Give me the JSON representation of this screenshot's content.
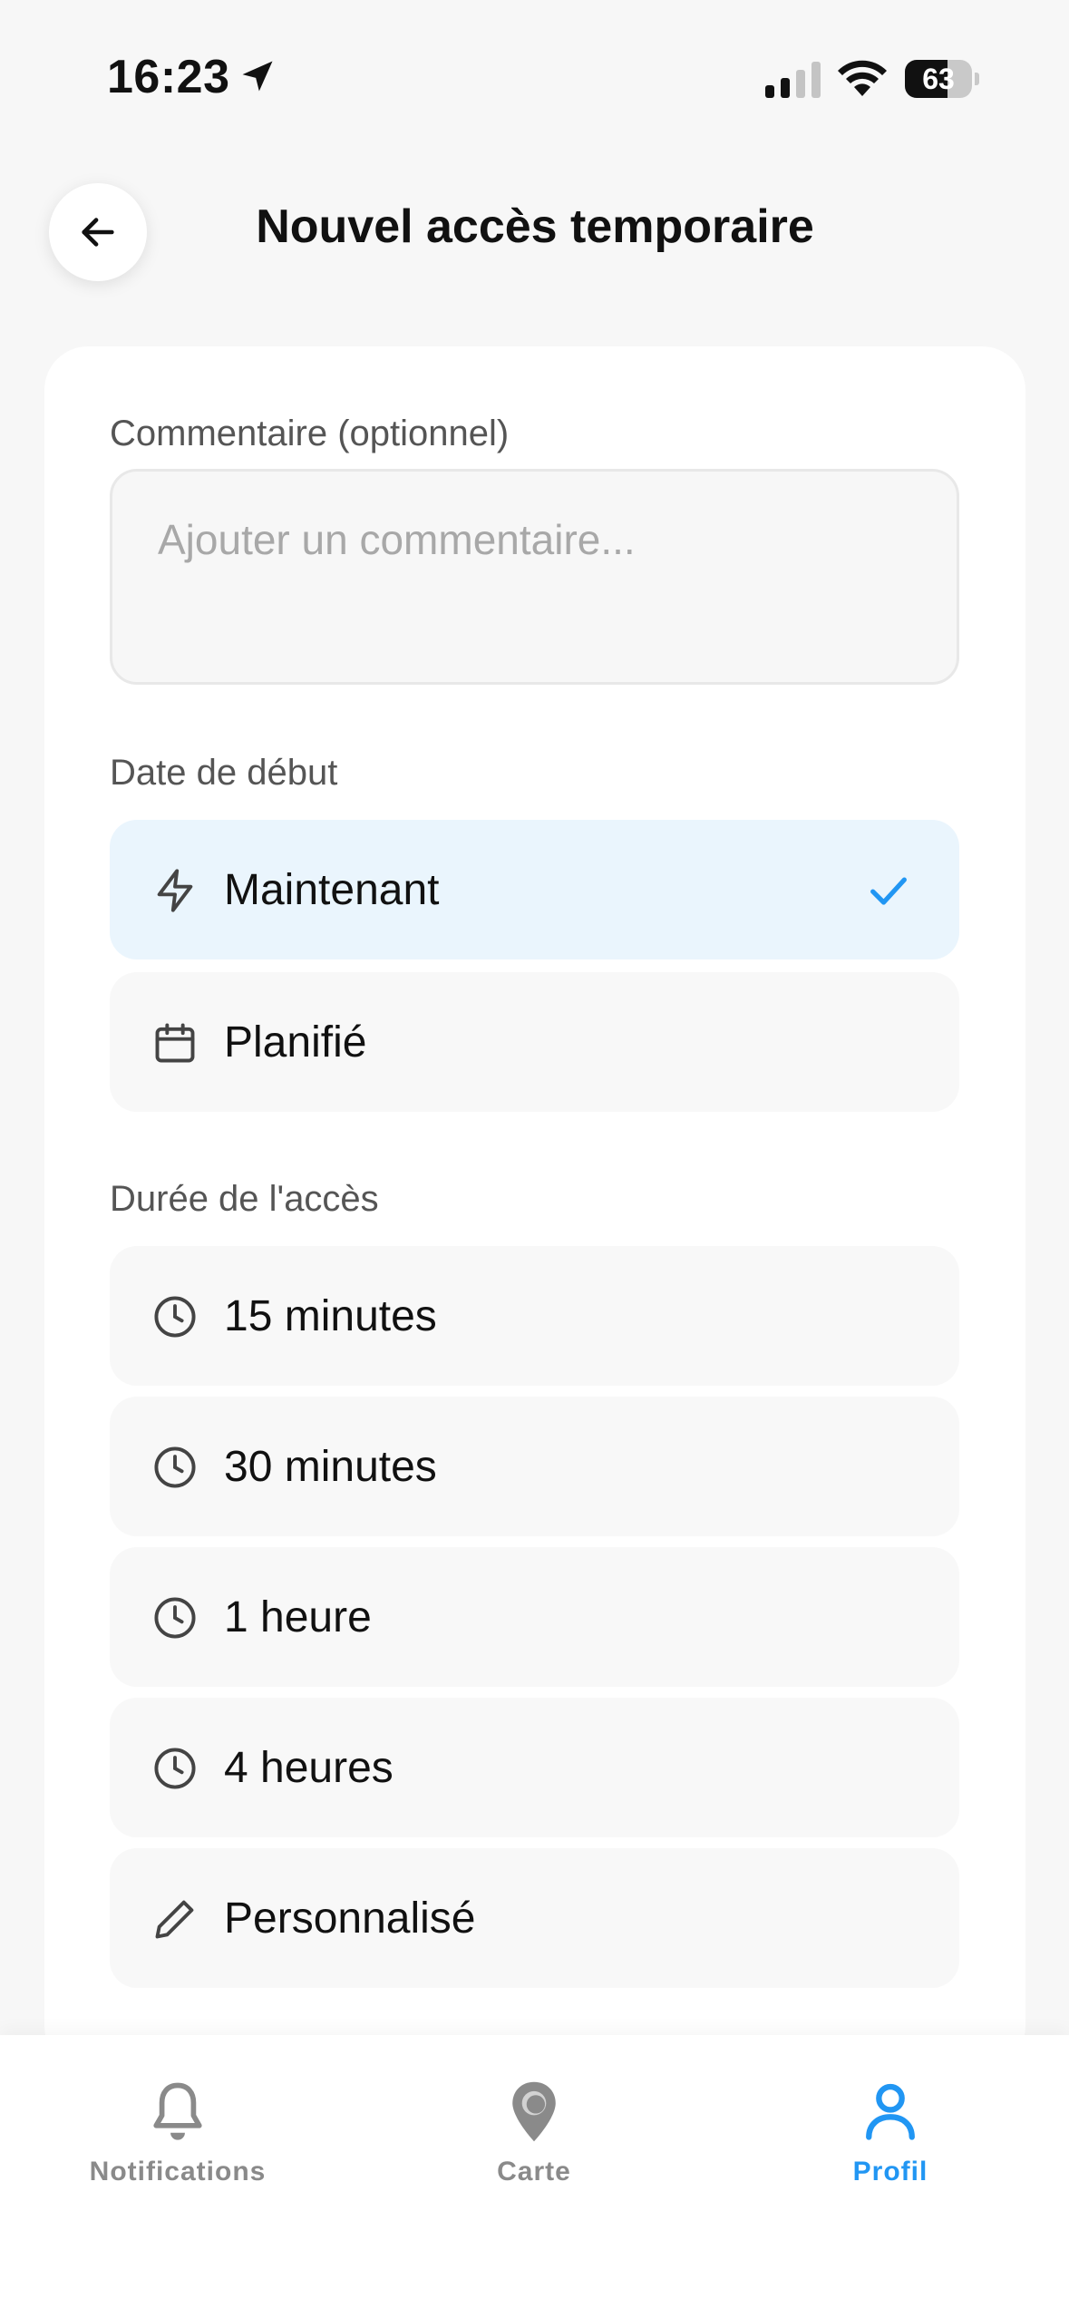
{
  "status_bar": {
    "time": "16:23",
    "battery_level": "63",
    "battery_fraction": 0.63
  },
  "header": {
    "title": "Nouvel accès temporaire",
    "back_icon": "arrow-left-icon"
  },
  "comment": {
    "label": "Commentaire (optionnel)",
    "placeholder": "Ajouter un commentaire...",
    "value": ""
  },
  "start_date": {
    "label": "Date de début",
    "options": [
      {
        "label": "Maintenant",
        "icon": "lightning-icon",
        "selected": true
      },
      {
        "label": "Planifié",
        "icon": "calendar-icon",
        "selected": false
      }
    ]
  },
  "duration": {
    "label": "Durée de l'accès",
    "options": [
      {
        "label": "15 minutes",
        "icon": "clock-icon"
      },
      {
        "label": "30 minutes",
        "icon": "clock-icon"
      },
      {
        "label": "1 heure",
        "icon": "clock-icon"
      },
      {
        "label": "4 heures",
        "icon": "clock-icon"
      },
      {
        "label": "Personnalisé",
        "icon": "pencil-icon"
      }
    ]
  },
  "tab_bar": {
    "tabs": [
      {
        "label": "Notifications",
        "icon": "bell-icon",
        "active": false
      },
      {
        "label": "Carte",
        "icon": "map-pin-icon",
        "active": false
      },
      {
        "label": "Profil",
        "icon": "person-icon",
        "active": true
      }
    ]
  },
  "colors": {
    "accent": "#2196f3",
    "selected_bg": "#eaf5fd",
    "inactive_tab": "#8a8a8a"
  }
}
